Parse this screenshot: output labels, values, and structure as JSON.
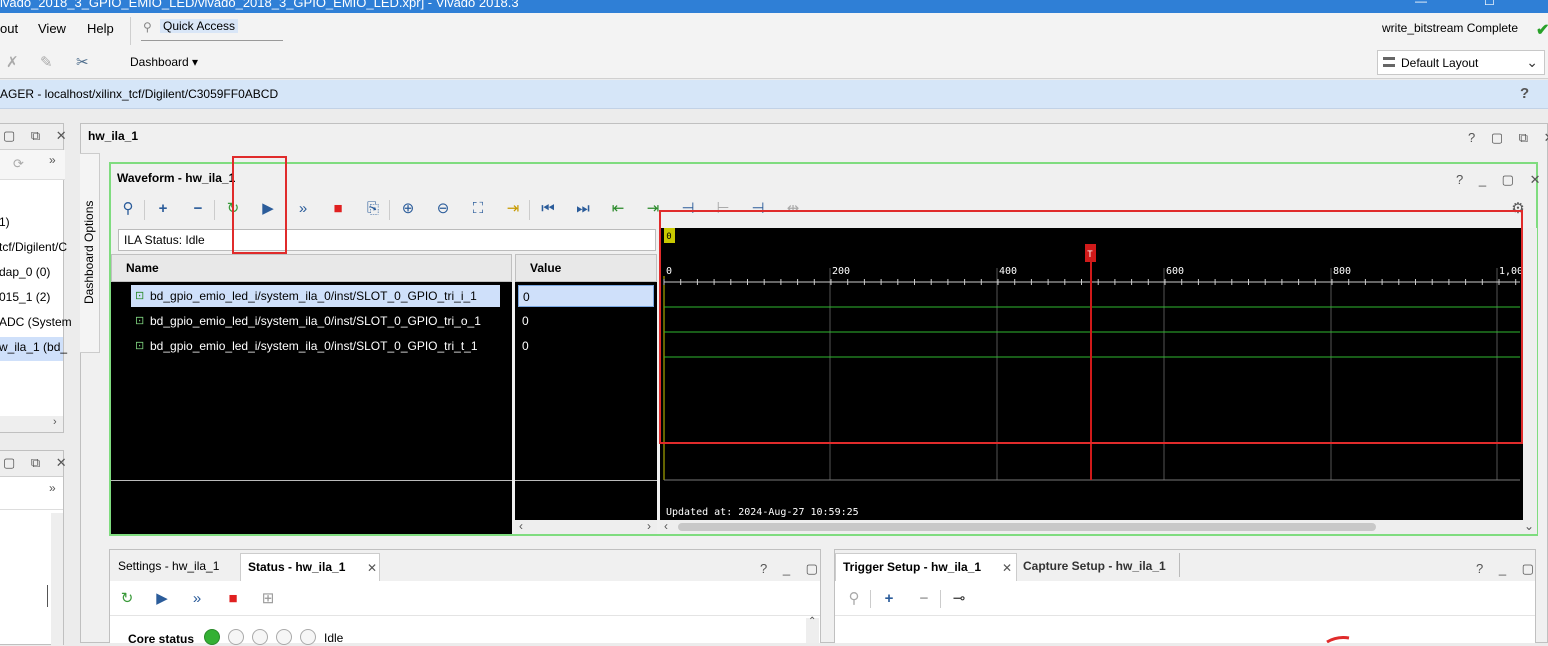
{
  "window": {
    "title": "ivado_2018_3_GPIO_EMIO_LED/vivado_2018_3_GPIO_EMIO_LED.xpr] - Vivado 2018.3"
  },
  "menu": {
    "items": [
      "out",
      "View",
      "Help"
    ],
    "quick_access": "Quick Access",
    "dashboard": "Dashboard",
    "status": "write_bitstream Complete",
    "layout": "Default Layout"
  },
  "banner": {
    "text": "AGER - localhost/xilinx_tcf/Digilent/C3059FF0ABCD"
  },
  "left_panel": {
    "rows": [
      "1)",
      "tcf/Digilent/C",
      "dap_0 (0)",
      "015_1 (2)",
      "ADC (System",
      "w_ila_1 (bd_"
    ],
    "counts": [
      "(0)",
      "(2)"
    ]
  },
  "main_panel": {
    "title": "hw_ila_1",
    "dashboard_options": "Dashboard Options"
  },
  "waveform": {
    "title": "Waveform - hw_ila_1",
    "ila_status": "ILA Status: Idle",
    "name_header": "Name",
    "value_header": "Value",
    "signals": [
      {
        "name": "bd_gpio_emio_led_i/system_ila_0/inst/SLOT_0_GPIO_tri_i_1",
        "value": "0"
      },
      {
        "name": "bd_gpio_emio_led_i/system_ila_0/inst/SLOT_0_GPIO_tri_o_1",
        "value": "0"
      },
      {
        "name": "bd_gpio_emio_led_i/system_ila_0/inst/SLOT_0_GPIO_tri_t_1",
        "value": "0"
      }
    ],
    "timeline": {
      "ticks": [
        "0",
        "200",
        "400",
        "600",
        "800",
        "1,00"
      ],
      "cursor_marker": "0",
      "trigger_marker": "T"
    },
    "updated": "Updated at: 2024-Aug-27 10:59:25"
  },
  "settings_panel": {
    "tab1": "Settings - hw_ila_1",
    "tab2": "Status - hw_ila_1",
    "core_status_label": "Core status",
    "core_status_value": "Idle"
  },
  "trigger_panel": {
    "tab1": "Trigger Setup - hw_ila_1",
    "tab2": "Capture Setup - hw_ila_1"
  },
  "colors": {
    "waveform_border": "#7fdc7f",
    "annotation": "#e02b2b",
    "signal_line": "#2fb82f",
    "trigger_line": "#d01a1a"
  }
}
